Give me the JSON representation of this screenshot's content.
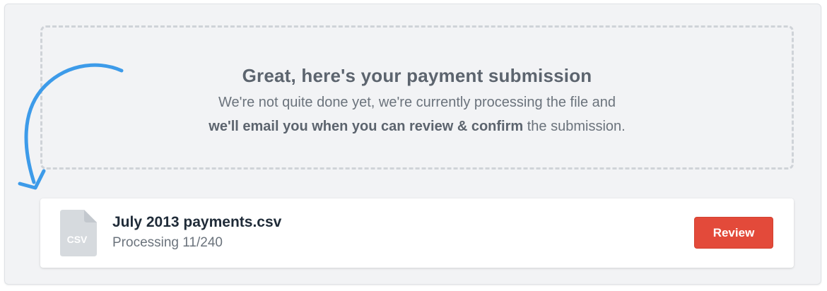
{
  "dropzone": {
    "title": "Great, here's your payment submission",
    "line1": "We're not quite done yet, we're currently processing the file and",
    "line2_bold": "we'll email you when you can review & confirm",
    "line2_rest": " the submission."
  },
  "file": {
    "icon_label": "CSV",
    "name": "July 2013 payments.csv",
    "status": "Processing 11/240",
    "progress": {
      "done": 11,
      "total": 240
    }
  },
  "actions": {
    "review_label": "Review"
  },
  "colors": {
    "panel_bg": "#f2f3f5",
    "dashed_border": "#cfd3d8",
    "arrow": "#3d9be9",
    "review_button": "#e34a3a",
    "file_icon": "#d6dade"
  },
  "icons": {
    "arrow": "curved-arrow-icon",
    "file": "csv-file-icon"
  }
}
